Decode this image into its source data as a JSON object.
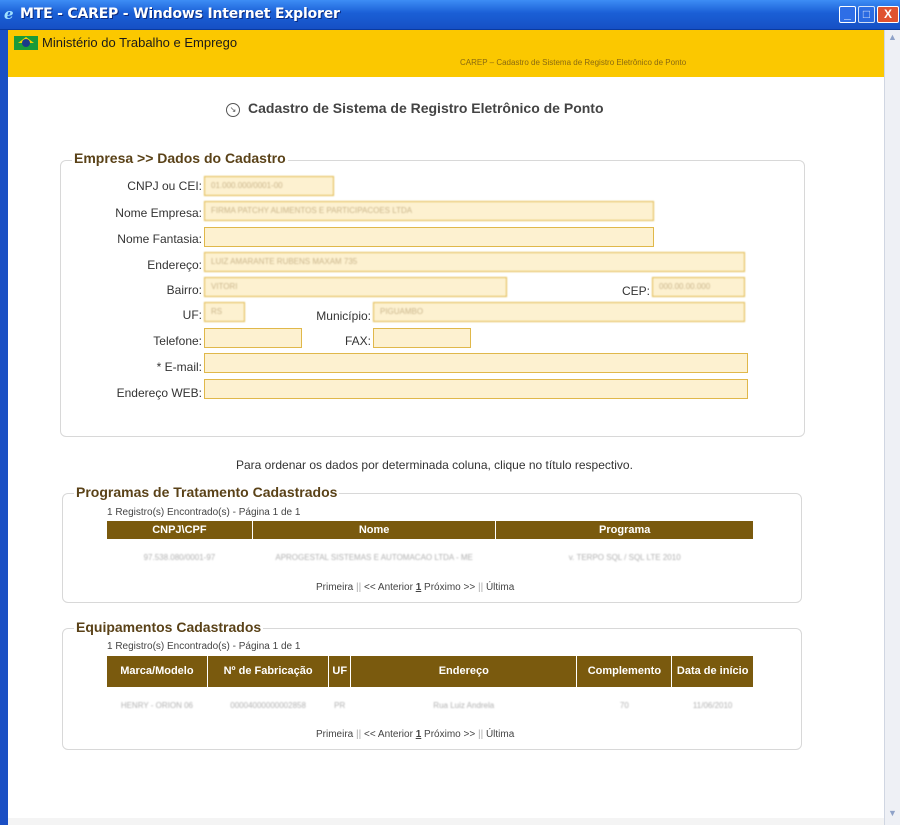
{
  "window": {
    "title": "MTE - CAREP - Windows Internet Explorer",
    "min_glyph": "_",
    "max_glyph": "□",
    "close_glyph": "X"
  },
  "header": {
    "ministry": "Ministério do Trabalho e Emprego",
    "subtitle": "CAREP – Cadastro de Sistema de Registro Eletrônico de Ponto"
  },
  "page_title": "Cadastro de Sistema de Registro Eletrônico de Ponto",
  "empresa": {
    "legend": "Empresa >> Dados do Cadastro",
    "fields": {
      "cnpj": {
        "label": "CNPJ ou CEI:",
        "value": "01.000.000/0001-00"
      },
      "nome": {
        "label": "Nome Empresa:",
        "value": "FIRMA PATCHY ALIMENTOS E PARTICIPACOES LTDA"
      },
      "fantasia": {
        "label": "Nome Fantasia:",
        "value": ""
      },
      "endereco": {
        "label": "Endereço:",
        "value": "LUIZ AMARANTE RUBENS MAXAM 735"
      },
      "bairro": {
        "label": "Bairro:",
        "value": "VITORI"
      },
      "cep": {
        "label": "CEP:",
        "value": "000.00.00.000"
      },
      "uf": {
        "label": "UF:",
        "value": "RS"
      },
      "municipio": {
        "label": "Município:",
        "value": "PIGUAMBO"
      },
      "telefone": {
        "label": "Telefone:",
        "value": ""
      },
      "fax": {
        "label": "FAX:",
        "value": ""
      },
      "email": {
        "label": "* E-mail:",
        "value": ""
      },
      "web": {
        "label": "Endereço WEB:",
        "value": ""
      }
    }
  },
  "sort_hint": "Para ordenar os dados por determinada coluna, clique no título respectivo.",
  "programas": {
    "legend": "Programas de Tratamento Cadastrados",
    "count": "1 Registro(s) Encontrado(s) - Página 1 de 1",
    "columns": [
      "CNPJ\\CPF",
      "Nome",
      "Programa"
    ],
    "rows": [
      [
        "97.538.080/0001-97",
        "APROGESTAL SISTEMAS E AUTOMACAO LTDA - ME",
        "v. TERPO SQL / SQL LTE 2010"
      ]
    ]
  },
  "equipamentos": {
    "legend": "Equipamentos Cadastrados",
    "count": "1 Registro(s) Encontrado(s) - Página 1 de 1",
    "columns": [
      "Marca/Modelo",
      "Nº de Fabricação",
      "UF",
      "Endereço",
      "Complemento",
      "Data de início"
    ],
    "rows": [
      [
        "HENRY - ORION 06",
        "00004000000002858",
        "PR",
        "Rua Luiz Andrela",
        "70",
        "11/06/2010"
      ]
    ]
  },
  "pager": {
    "first": "Primeira",
    "sep": "||",
    "prev": "<< Anterior",
    "current": "1",
    "next": "Próximo >>",
    "last": "Última"
  }
}
